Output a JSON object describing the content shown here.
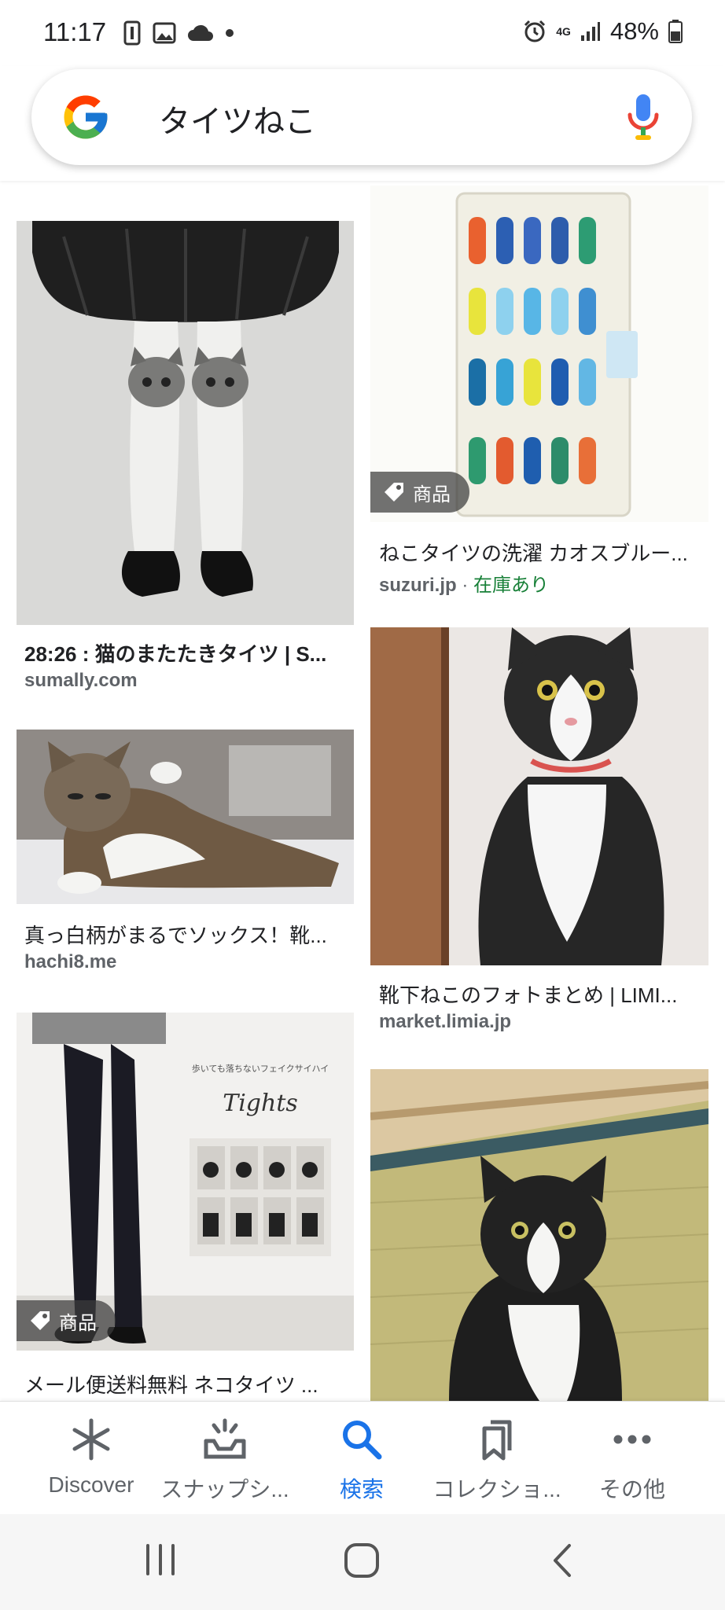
{
  "status_bar": {
    "time": "11:17",
    "network": "4G",
    "battery": "48%"
  },
  "search": {
    "query": "タイツねこ"
  },
  "results": [
    {
      "title": "28:26 : 猫のまたたきタイツ | S...",
      "source": "sumally.com"
    },
    {
      "title": "ねこタイツの洗濯 カオスブルー...",
      "source": "suzuri.jp",
      "stock": "在庫あり",
      "badge": "商品"
    },
    {
      "title": "真っ白柄がまるでソックス！靴...",
      "source": "hachi8.me"
    },
    {
      "title": "靴下ねこのフォトまとめ | LIMI...",
      "source": "market.limia.jp"
    },
    {
      "title": "メール便送料無料 ネコタイツ ...",
      "badge": "商品",
      "image_text": "歩いても落ちないフェイクサイハイ",
      "image_script": "Tights"
    }
  ],
  "bottom_nav": {
    "items": [
      {
        "label": "Discover",
        "icon": "asterisk-icon"
      },
      {
        "label": "スナップシ...",
        "icon": "snapshot-icon"
      },
      {
        "label": "検索",
        "icon": "search-icon",
        "active": true
      },
      {
        "label": "コレクショ...",
        "icon": "bookmark-icon"
      },
      {
        "label": "その他",
        "icon": "more-icon"
      }
    ]
  },
  "colors": {
    "accent": "#1a73e8",
    "instock": "#188038",
    "secondary_text": "#5f6368"
  }
}
